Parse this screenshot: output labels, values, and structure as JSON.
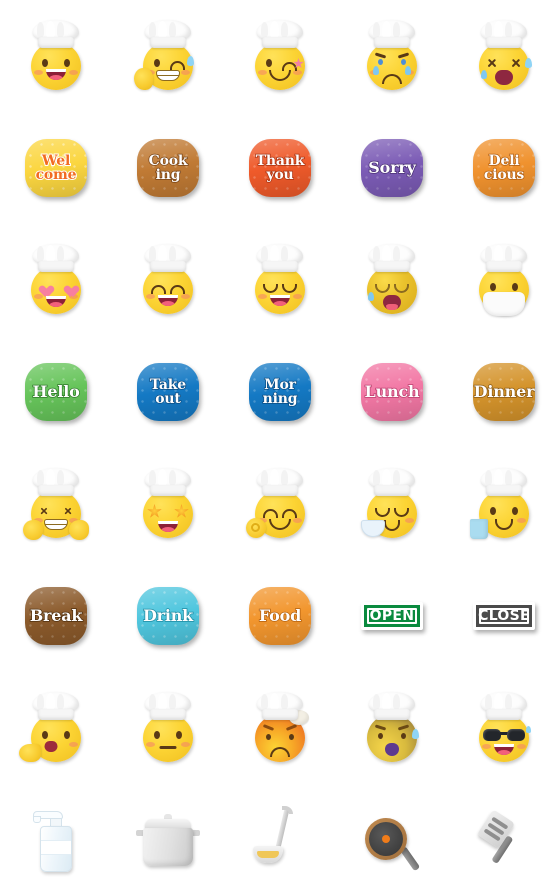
{
  "sheet": {
    "title": "Chef Emoji Sticker Sheet",
    "background": "#ffffff",
    "columns": 5,
    "rows": 8
  },
  "rows": [
    {
      "kind": "faces",
      "items": [
        {
          "name": "chef-smile-open-mouth",
          "label": "chef smiling with open mouth"
        },
        {
          "name": "chef-wink-thumbs-up",
          "label": "chef winking with thumbs up"
        },
        {
          "name": "chef-wink-star",
          "label": "chef winking with star"
        },
        {
          "name": "chef-sad-tears",
          "label": "chef sad with tears"
        },
        {
          "name": "chef-dizzy-x-eyes",
          "label": "chef dizzy with x eyes"
        }
      ]
    },
    {
      "kind": "badges",
      "items": [
        {
          "name": "badge-welcome",
          "text": "Wel\ncome",
          "lines": 2,
          "bg": "#FBD640",
          "fg": "#F26B21",
          "pattern": true,
          "stroke": "#ffffff"
        },
        {
          "name": "badge-cooking",
          "text": "Cook\ning",
          "lines": 2,
          "bg": "#C07A34",
          "fg": "#FFFFFF",
          "pattern": true,
          "stroke": "#7A4517"
        },
        {
          "name": "badge-thank-you",
          "text": "Thank\nyou",
          "lines": 2,
          "bg": "#EF5A2A",
          "fg": "#FFFFFF",
          "pattern": true,
          "stroke": "#A83312"
        },
        {
          "name": "badge-sorry",
          "text": "Sorry",
          "lines": 1,
          "bg": "#7B5BB5",
          "fg": "#FFFFFF",
          "pattern": true,
          "stroke": "#4A3075"
        },
        {
          "name": "badge-delicious",
          "text": "Deli\ncious",
          "lines": 2,
          "bg": "#F0922E",
          "fg": "#FFFFFF",
          "pattern": true,
          "stroke": "#B35F12"
        }
      ]
    },
    {
      "kind": "faces",
      "items": [
        {
          "name": "chef-heart-eyes",
          "label": "chef with heart eyes"
        },
        {
          "name": "chef-happy-closed-eyes",
          "label": "chef grinning with closed eyes"
        },
        {
          "name": "chef-relaxed-smile",
          "label": "chef relaxed smiling"
        },
        {
          "name": "chef-weary-crying",
          "label": "chef weary and crying"
        },
        {
          "name": "chef-face-mask",
          "label": "chef wearing face mask"
        }
      ]
    },
    {
      "kind": "badges",
      "items": [
        {
          "name": "badge-hello",
          "text": "Hello",
          "lines": 1,
          "bg": "#66C45A",
          "fg": "#FFFFFF",
          "pattern": true,
          "stroke": "#2F7A2A"
        },
        {
          "name": "badge-takeout",
          "text": "Take\nout",
          "lines": 2,
          "bg": "#1479C4",
          "fg": "#FFFFFF",
          "pattern": true,
          "stroke": "#0B4E85"
        },
        {
          "name": "badge-morning",
          "text": "Mor\nning",
          "lines": 2,
          "bg": "#1479C4",
          "fg": "#FFFFFF",
          "pattern": true,
          "stroke": "#0B4E85"
        },
        {
          "name": "badge-lunch",
          "text": "Lunch",
          "lines": 1,
          "bg": "#F277A4",
          "fg": "#FFFFFF",
          "pattern": true,
          "stroke": "#BD3F6F"
        },
        {
          "name": "badge-dinner",
          "text": "Dinner",
          "lines": 1,
          "bg": "#D4932B",
          "fg": "#FFFFFF",
          "pattern": true,
          "stroke": "#8C5A12"
        }
      ]
    },
    {
      "kind": "faces",
      "items": [
        {
          "name": "chef-excited-fists",
          "label": "chef excited with fists"
        },
        {
          "name": "chef-star-eyes",
          "label": "chef with star struck eyes"
        },
        {
          "name": "chef-ok-hand",
          "label": "chef making ok hand sign"
        },
        {
          "name": "chef-eating-bowl",
          "label": "chef eating from bowl"
        },
        {
          "name": "chef-holding-cup",
          "label": "chef holding drink cup"
        }
      ]
    },
    {
      "kind": "badges",
      "items": [
        {
          "name": "badge-break",
          "text": "Break",
          "lines": 1,
          "bg": "#8B5A2B",
          "fg": "#FFFFFF",
          "pattern": true,
          "stroke": "#50300F"
        },
        {
          "name": "badge-drink",
          "text": "Drink",
          "lines": 1,
          "bg": "#4FC6DE",
          "fg": "#FFFFFF",
          "pattern": true,
          "stroke": "#1F8CA3"
        },
        {
          "name": "badge-food",
          "text": "Food",
          "lines": 1,
          "bg": "#F2962E",
          "fg": "#FFFFFF",
          "pattern": true,
          "stroke": "#B3600F"
        },
        {
          "name": "sign-open",
          "text": "OPEN",
          "lines": 1,
          "bg": "#0A8A3E",
          "fg": "#FFFFFF",
          "sign": true
        },
        {
          "name": "sign-close",
          "text": "CLOSE",
          "lines": 1,
          "bg": "#4A4A4A",
          "fg": "#FFFFFF",
          "sign": true
        }
      ]
    },
    {
      "kind": "faces",
      "items": [
        {
          "name": "chef-waving-talking",
          "label": "chef waving and talking"
        },
        {
          "name": "chef-neutral",
          "label": "chef with neutral face"
        },
        {
          "name": "chef-angry-steam",
          "label": "chef angry with steam"
        },
        {
          "name": "chef-shocked-pale",
          "label": "chef shocked and pale"
        },
        {
          "name": "chef-sunglasses",
          "label": "chef wearing sunglasses"
        }
      ]
    },
    {
      "kind": "utensils",
      "items": [
        {
          "name": "hand-sanitizer-bottle",
          "label": "hand sanitizer bottle"
        },
        {
          "name": "cooking-pot",
          "label": "cooking pot with lid"
        },
        {
          "name": "soup-ladle",
          "label": "soup ladle"
        },
        {
          "name": "frying-pan",
          "label": "frying pan with egg"
        },
        {
          "name": "spatula-turner",
          "label": "spatula turner"
        }
      ]
    }
  ]
}
